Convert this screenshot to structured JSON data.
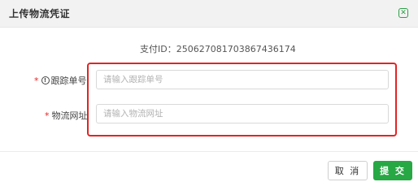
{
  "dialog": {
    "title": "上传物流凭证",
    "close_icon": "close-icon",
    "accent_color": "#2e9e4a"
  },
  "payment": {
    "label": "支付ID：",
    "value": "250627081703867436174"
  },
  "form": {
    "required_mark": "*",
    "tracking": {
      "label": "跟踪单号",
      "info_icon": "info-icon",
      "placeholder": "请输入跟踪单号",
      "value": ""
    },
    "logistics_url": {
      "label": "物流网址",
      "placeholder": "请输入物流网址",
      "value": ""
    },
    "highlight_color": "#e42323"
  },
  "footer": {
    "cancel_label": "取 消",
    "submit_label": "提 交",
    "submit_color": "#28a745"
  }
}
